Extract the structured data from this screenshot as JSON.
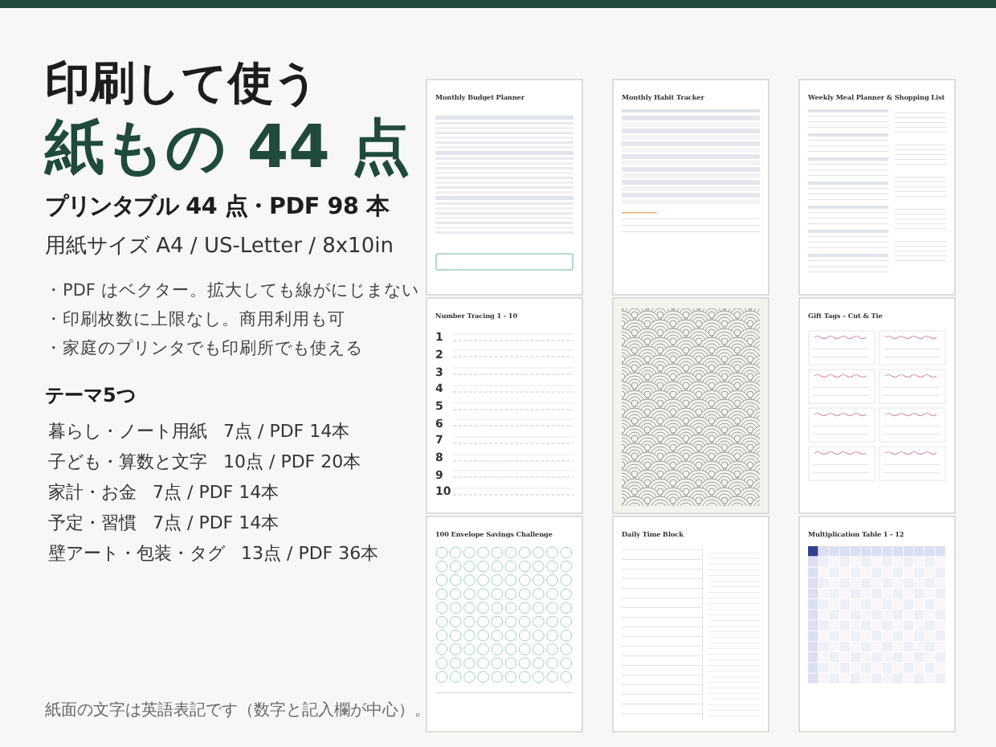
{
  "headline": {
    "line_1": "印刷して使う",
    "line_2": "紙もの 44 点"
  },
  "subtitle": "プリンタブル 44 点・PDF 98 本",
  "paper_sizes": "用紙サイズ A4 / US-Letter / 8x10in",
  "bullets": [
    "・PDF はベクター。拡大しても線がにじまない",
    "・印刷枚数に上限なし。商用利用も可",
    "・家庭のプリンタでも印刷所でも使える"
  ],
  "themes": {
    "heading": "テーマ5つ",
    "items": [
      {
        "name": "暮らし・ノート用紙",
        "count": "7点 / PDF 14本"
      },
      {
        "name": "子ども・算数と文字",
        "count": "10点 / PDF 20本"
      },
      {
        "name": "家計・お金",
        "count": "7点 / PDF 14本"
      },
      {
        "name": "予定・習慣",
        "count": "7点 / PDF 14本"
      },
      {
        "name": "壁アート・包装・タグ",
        "count": "13点 / PDF 36本"
      }
    ]
  },
  "footnote": "紙面の文字は英語表記です（数字と記入欄が中心）。",
  "pages": [
    {
      "kind": "budget",
      "title": "Monthly Budget Planner"
    },
    {
      "kind": "habit",
      "title": "Monthly Habit Tracker"
    },
    {
      "kind": "meal",
      "title": "Weekly Meal Planner & Shopping List"
    },
    {
      "kind": "tracing",
      "title": "Number Tracing  1 - 10",
      "digits": [
        "1",
        "2",
        "3",
        "4",
        "5",
        "6",
        "7",
        "8",
        "9",
        "10"
      ]
    },
    {
      "kind": "pattern"
    },
    {
      "kind": "tags",
      "title": "Gift Tags  –  Cut & Tie"
    },
    {
      "kind": "envelope",
      "title": "100 Envelope Savings Challenge"
    },
    {
      "kind": "timeblock",
      "title": "Daily Time Block"
    },
    {
      "kind": "multiplication",
      "title": "Multiplication Table  1 - 12"
    }
  ]
}
